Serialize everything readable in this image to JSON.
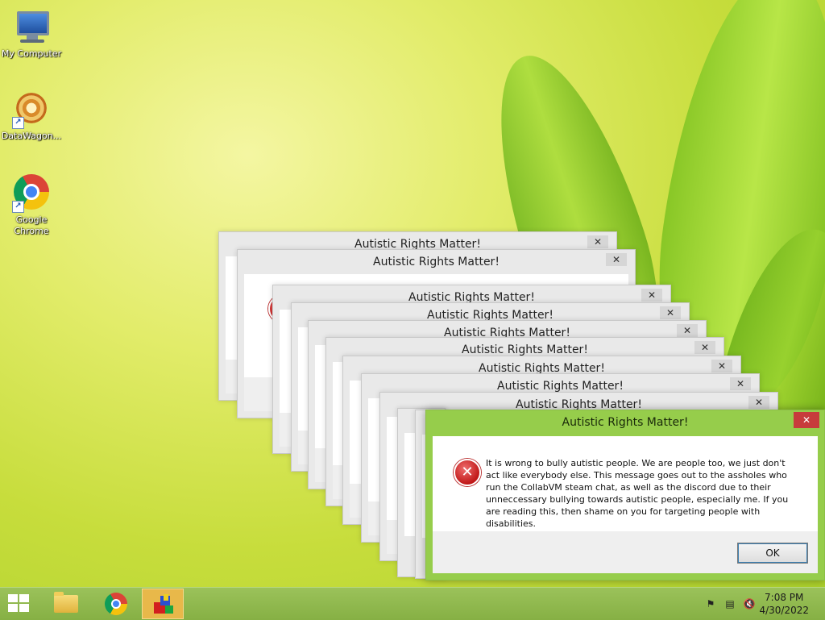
{
  "desktop": {
    "icons": [
      {
        "label": "My Computer",
        "icon": "computer-icon"
      },
      {
        "label": "DataWagon...",
        "icon": "datawagon-icon"
      },
      {
        "label": "Google Chrome",
        "icon": "chrome-icon"
      }
    ]
  },
  "dialog": {
    "title": "Autistic Rights Matter!",
    "close_label": "✕",
    "message": "It is wrong to bully autistic people. We are people too, we just don't act like everybody else. This message goes out to the assholes who run the CollabVM steam chat, as well as the discord due to their unneccessary bullying towards autistic people, especially me. If you are reading this, then shame on you for targeting people with disabilities.",
    "ok_label": "OK",
    "icon": "error-icon"
  },
  "taskbar": {
    "items": [
      "start-button",
      "file-explorer-icon",
      "chrome-icon",
      "app-cube-icon"
    ],
    "tray": [
      "action-center-flag-icon",
      "network-icon",
      "volume-muted-icon"
    ],
    "time": "7:08 PM",
    "date": "4/30/2022"
  },
  "colors": {
    "accent": "#96cd4b",
    "close": "#c73c3c"
  }
}
